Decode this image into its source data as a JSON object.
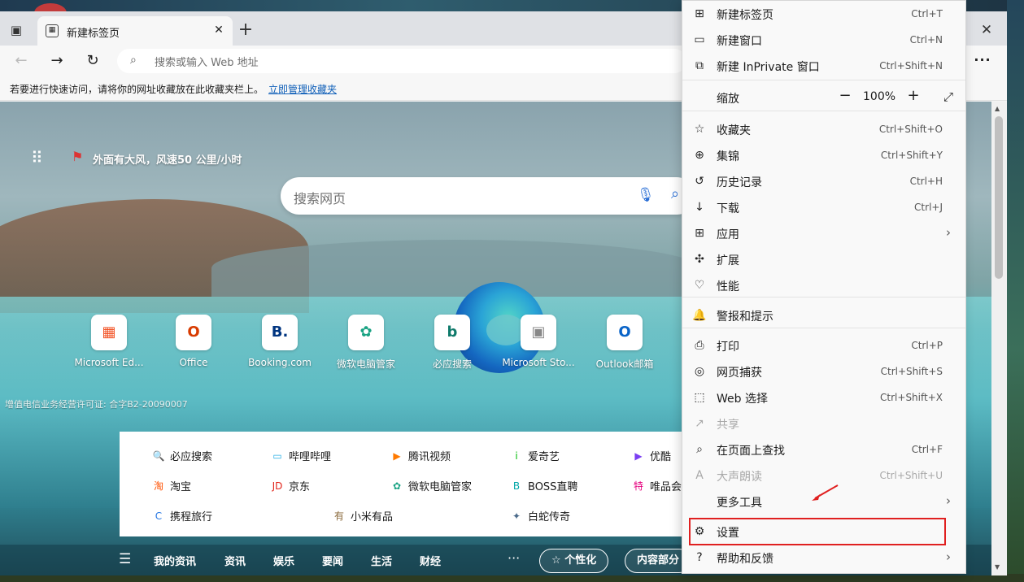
{
  "tab": {
    "title": "新建标签页"
  },
  "toolbar": {
    "address_placeholder": "搜索或输入 Web 地址"
  },
  "favbar": {
    "message": "若要进行快速访问，请将你的网址收藏放在此收藏夹栏上。",
    "link": "立即管理收藏夹"
  },
  "weather": {
    "text": "外面有大风，风速50 公里/小时"
  },
  "search": {
    "placeholder": "搜索网页"
  },
  "quick_links": [
    {
      "label": "Microsoft Ed...",
      "icon": "microsoft-logo-icon",
      "glyph": "▦",
      "color": "#f25022"
    },
    {
      "label": "Office",
      "icon": "office-logo-icon",
      "glyph": "O",
      "color": "#d83b01"
    },
    {
      "label": "Booking.com",
      "icon": "booking-logo-icon",
      "glyph": "B.",
      "color": "#003580"
    },
    {
      "label": "微软电脑管家",
      "icon": "pc-manager-logo-icon",
      "glyph": "✿",
      "color": "#1aa384"
    },
    {
      "label": "必应搜索",
      "icon": "bing-logo-icon",
      "glyph": "b",
      "color": "#0f7a6b"
    },
    {
      "label": "Microsoft Sto...",
      "icon": "store-logo-icon",
      "glyph": "▣",
      "color": "#888888"
    },
    {
      "label": "Outlook邮箱",
      "icon": "outlook-logo-icon",
      "glyph": "O",
      "color": "#0a64c8"
    }
  ],
  "license": "增值电信业务经营许可证: 合字B2-20090007",
  "links_panel": [
    {
      "label": "必应搜索",
      "icon": "search-icon",
      "glyph": "🔍",
      "color": "#1a73e8"
    },
    {
      "label": "哔哩哔哩",
      "icon": "bilibili-icon",
      "glyph": "▭",
      "color": "#23ade5"
    },
    {
      "label": "腾讯视频",
      "icon": "tencent-video-icon",
      "glyph": "▶",
      "color": "#ff7a00"
    },
    {
      "label": "爱奇艺",
      "icon": "iqiyi-icon",
      "glyph": "i",
      "color": "#00be06"
    },
    {
      "label": "优酷",
      "icon": "youku-icon",
      "glyph": "▶",
      "color": "#7b3ff2"
    },
    {
      "label": "淘宝",
      "icon": "taobao-icon",
      "glyph": "淘",
      "color": "#ff5000"
    },
    {
      "label": "京东",
      "icon": "jd-icon",
      "glyph": "JD",
      "color": "#e1251b"
    },
    {
      "label": "微软电脑管家",
      "icon": "pc-manager-icon",
      "glyph": "✿",
      "color": "#1aa384"
    },
    {
      "label": "BOSS直聘",
      "icon": "boss-icon",
      "glyph": "B",
      "color": "#00a6a7"
    },
    {
      "label": "唯品会",
      "icon": "vip-icon",
      "glyph": "特",
      "color": "#e5007e"
    },
    {
      "label": "携程旅行",
      "icon": "ctrip-icon",
      "glyph": "C",
      "color": "#2577e3"
    },
    {
      "label": "小米有品",
      "icon": "xiaomi-youpin-icon",
      "glyph": "有",
      "color": "#8b6b3d"
    },
    {
      "label": "白蛇传奇",
      "icon": "game-icon",
      "glyph": "✦",
      "color": "#4a6a8a"
    }
  ],
  "feed": {
    "tabs": [
      "我的资讯",
      "资讯",
      "娱乐",
      "要闻",
      "生活",
      "财经"
    ],
    "personalize": "个性化",
    "content_partial": "内容部分"
  },
  "menu": {
    "items": [
      {
        "label": "新建标签页",
        "shortcut": "Ctrl+T",
        "icon": "new-tab-icon",
        "glyph": "⊞"
      },
      {
        "label": "新建窗口",
        "shortcut": "Ctrl+N",
        "icon": "new-window-icon",
        "glyph": "▭"
      },
      {
        "label": "新建 InPrivate 窗口",
        "shortcut": "Ctrl+Shift+N",
        "icon": "inprivate-icon",
        "glyph": "⧉"
      },
      {
        "label": "缩放",
        "shortcut": "",
        "icon": "",
        "glyph": ""
      },
      {
        "label": "收藏夹",
        "shortcut": "Ctrl+Shift+O",
        "icon": "favorites-icon",
        "glyph": "☆"
      },
      {
        "label": "集锦",
        "shortcut": "Ctrl+Shift+Y",
        "icon": "collections-icon",
        "glyph": "⊕"
      },
      {
        "label": "历史记录",
        "shortcut": "Ctrl+H",
        "icon": "history-icon",
        "glyph": "↺"
      },
      {
        "label": "下载",
        "shortcut": "Ctrl+J",
        "icon": "download-icon",
        "glyph": "↓"
      },
      {
        "label": "应用",
        "shortcut": "",
        "icon": "apps-icon",
        "glyph": "⊞"
      },
      {
        "label": "扩展",
        "shortcut": "",
        "icon": "extensions-icon",
        "glyph": "✣"
      },
      {
        "label": "性能",
        "shortcut": "",
        "icon": "performance-icon",
        "glyph": "♡"
      },
      {
        "label": "警报和提示",
        "shortcut": "",
        "icon": "bell-icon",
        "glyph": "🔔"
      },
      {
        "label": "打印",
        "shortcut": "Ctrl+P",
        "icon": "print-icon",
        "glyph": "⎙"
      },
      {
        "label": "网页捕获",
        "shortcut": "Ctrl+Shift+S",
        "icon": "capture-icon",
        "glyph": "◎"
      },
      {
        "label": "Web 选择",
        "shortcut": "Ctrl+Shift+X",
        "icon": "web-select-icon",
        "glyph": "⬚"
      },
      {
        "label": "共享",
        "shortcut": "",
        "icon": "share-icon",
        "glyph": "↗"
      },
      {
        "label": "在页面上查找",
        "shortcut": "Ctrl+F",
        "icon": "find-icon",
        "glyph": "⌕"
      },
      {
        "label": "大声朗读",
        "shortcut": "Ctrl+Shift+U",
        "icon": "read-aloud-icon",
        "glyph": "A"
      },
      {
        "label": "更多工具",
        "shortcut": "",
        "icon": "",
        "glyph": ""
      },
      {
        "label": "设置",
        "shortcut": "",
        "icon": "gear-icon",
        "glyph": "⚙"
      },
      {
        "label": "帮助和反馈",
        "shortcut": "",
        "icon": "help-icon",
        "glyph": "?"
      }
    ],
    "zoom": {
      "value": "100%"
    }
  },
  "colors": {
    "highlight": "#e02020",
    "link": "#0f5fb8"
  }
}
